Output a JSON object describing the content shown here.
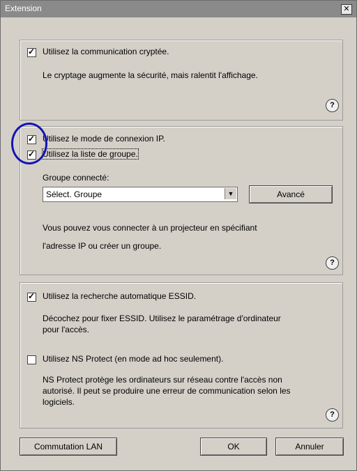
{
  "window": {
    "title": "Extension",
    "close_glyph": "✕"
  },
  "section1": {
    "checkbox_label": "Utilisez la communication cryptée.",
    "checked": true,
    "description": "Le cryptage augmente la sécurité, mais ralentit l'affichage.",
    "help": "?"
  },
  "section2": {
    "ip_mode_label": "Utilisez le mode de connexion IP.",
    "ip_mode_checked": true,
    "group_list_label": "Utilisez la liste de groupe.",
    "group_list_checked": true,
    "group_label": "Groupe connecté:",
    "group_select_value": "Sélect. Groupe",
    "advanced_button": "Avancé",
    "description_line1": "Vous pouvez vous connecter à un projecteur en spécifiant",
    "description_line2": "l'adresse IP ou créer un groupe.",
    "help": "?"
  },
  "section3": {
    "essid_label": "Utilisez la recherche automatique ESSID.",
    "essid_checked": true,
    "essid_desc_line1": "Décochez pour fixer ESSID. Utilisez le paramétrage d'ordinateur",
    "essid_desc_line2": "pour l'accès.",
    "ns_label": "Utilisez NS Protect (en mode ad hoc seulement).",
    "ns_checked": false,
    "ns_desc_line1": "NS Protect protège les ordinateurs sur réseau contre l'accès non",
    "ns_desc_line2": "autorisé. Il peut se produire une erreur de communication selon les",
    "ns_desc_line3": "logiciels.",
    "help": "?"
  },
  "buttons": {
    "lan": "Commutation LAN",
    "ok": "OK",
    "cancel": "Annuler"
  },
  "colors": {
    "annotation_circle": "#1414b4",
    "dialog_bg": "#d4d0c8"
  }
}
